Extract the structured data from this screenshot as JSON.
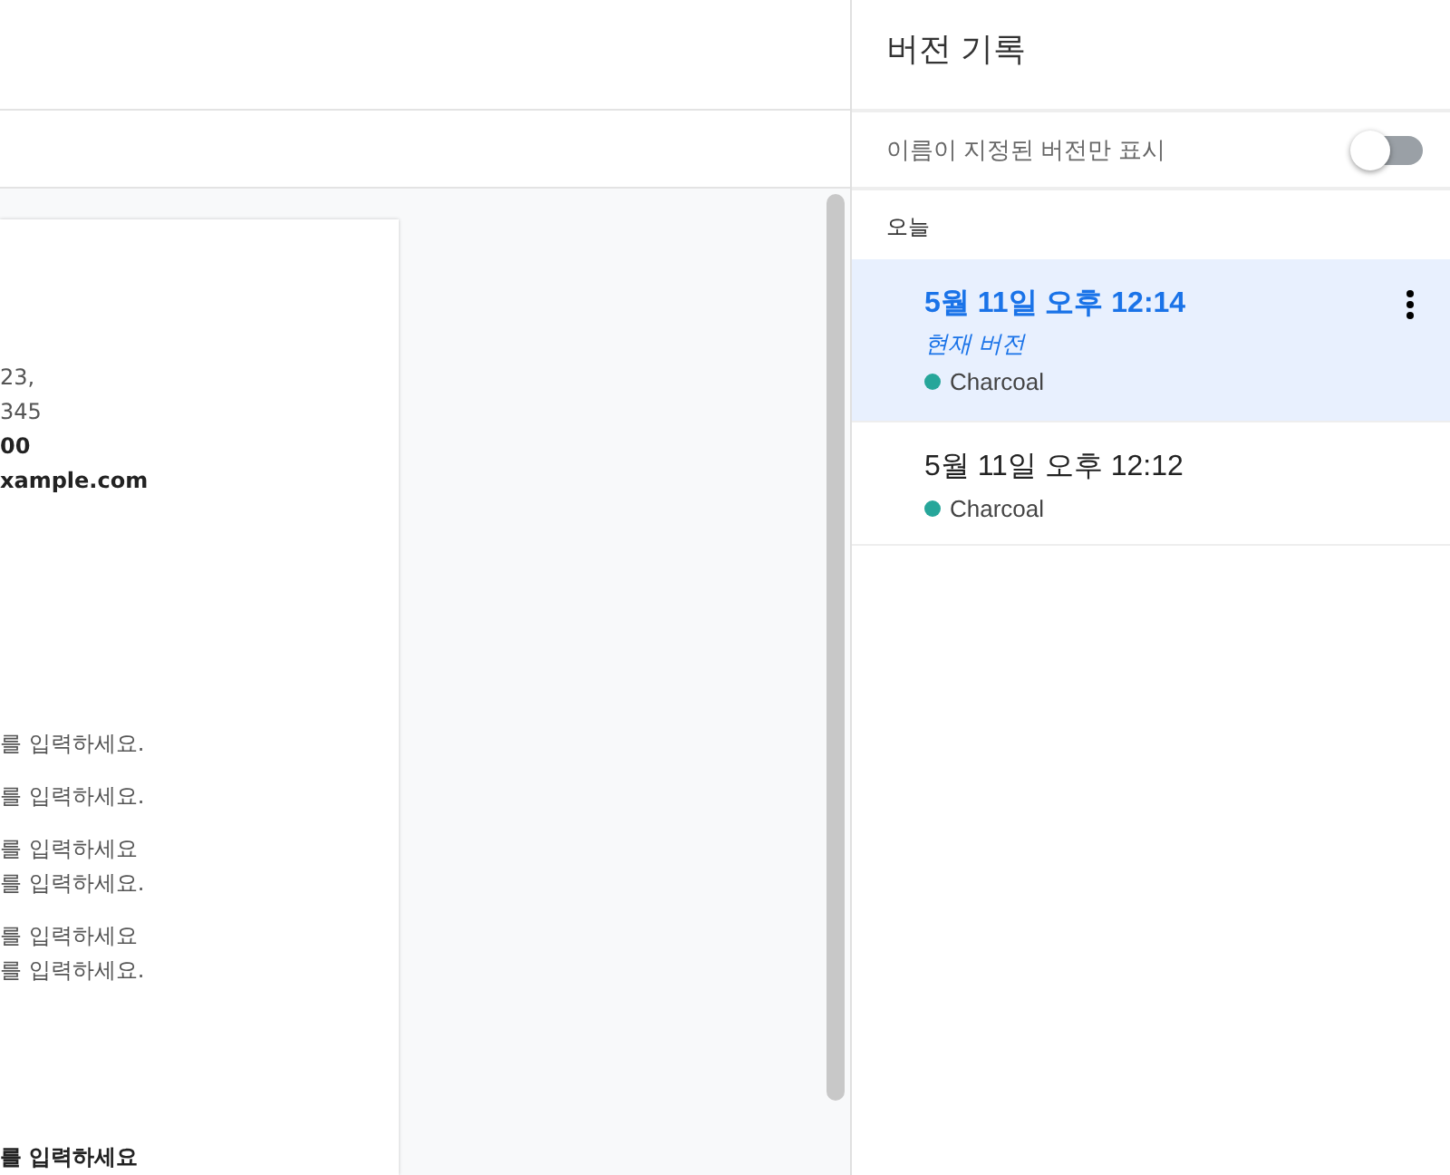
{
  "document": {
    "paragraphs": [
      {
        "lines": [
          {
            "text": "23,",
            "bold": false
          },
          {
            "text": "345",
            "bold": false
          },
          {
            "text": "00",
            "bold": true
          },
          {
            "text": "xample.com",
            "bold": true
          }
        ]
      },
      {
        "lines": [
          {
            "text": "를 입력하세요.",
            "bold": false
          }
        ]
      },
      {
        "lines": [
          {
            "text": "를 입력하세요.",
            "bold": false
          }
        ]
      },
      {
        "lines": [
          {
            "text": "를 입력하세요",
            "bold": false
          },
          {
            "text": "를 입력하세요.",
            "bold": false
          }
        ]
      },
      {
        "lines": [
          {
            "text": "를 입력하세요",
            "bold": false
          },
          {
            "text": "를 입력하세요.",
            "bold": false
          }
        ]
      },
      {
        "lines": [
          {
            "text": "를 입력하세요",
            "bold": true
          }
        ]
      }
    ]
  },
  "version_history": {
    "title": "버전 기록",
    "named_only": {
      "label": "이름이 지정된 버전만 표시",
      "on": false
    },
    "groups": [
      {
        "heading": "오늘",
        "versions": [
          {
            "date": "5월 11일 오후 12:14",
            "label": "현재 버전",
            "selected": true,
            "author": "Charcoal",
            "color": "#26a69a"
          },
          {
            "date": "5월 11일 오후 12:12",
            "selected": false,
            "author": "Charcoal",
            "color": "#26a69a"
          }
        ]
      }
    ]
  }
}
